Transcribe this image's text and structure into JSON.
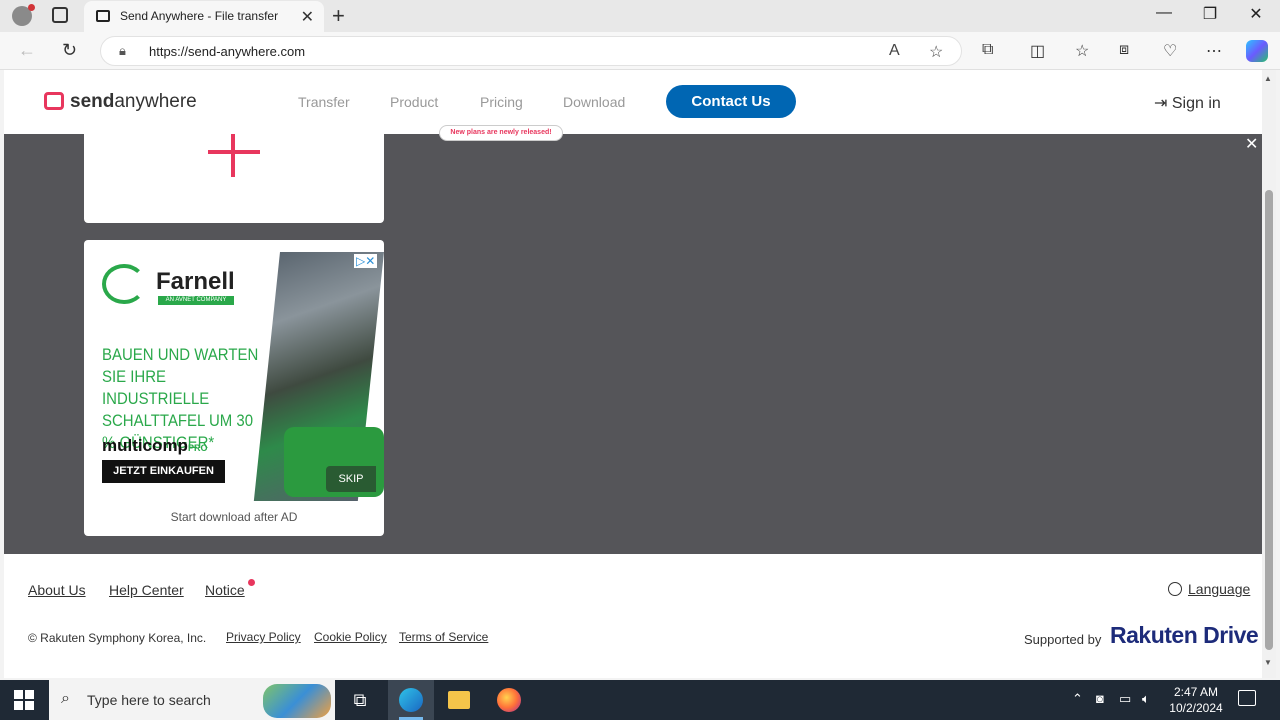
{
  "browser": {
    "tab_title": "Send Anywhere - File transfer",
    "url": "https://send-anywhere.com",
    "new_tab_glyph": "+",
    "tab_close_glyph": "✕"
  },
  "site": {
    "logo_prefix": "send",
    "logo_suffix": "anywhere",
    "nav": [
      "Transfer",
      "Product",
      "Pricing",
      "Download"
    ],
    "pricing_badge": "New plans are newly released!",
    "contact_button": "Contact Us",
    "sign_in": "Sign in",
    "overlay_close": "✕"
  },
  "ad": {
    "brand": "Farnell",
    "brand_sub": "AN AVNET COMPANY",
    "headline": "BAUEN UND WARTEN SIE IHRE INDUSTRIELLE SCHALTTAFEL UM 30 % GÜNSTIGER*",
    "product": "multicomp",
    "product_suffix": "PRO",
    "cta": "JETZT EINKAUFEN",
    "skip": "SKIP",
    "adchoices": "▷✕",
    "footer": "Start download after AD"
  },
  "footer": {
    "links": [
      "About Us",
      "Help Center",
      "Notice"
    ],
    "language": "Language",
    "copyright": "© Rakuten Symphony Korea, Inc.",
    "legal": [
      "Privacy Policy",
      "Cookie Policy",
      "Terms of Service"
    ],
    "supported_by": "Supported by",
    "partner_a": "Rakuten",
    "partner_b": "Drive"
  },
  "taskbar": {
    "search_placeholder": "Type here to search",
    "time": "2:47 AM",
    "date": "10/2/2024"
  },
  "colors": {
    "brand": "#e8365d",
    "contact": "#0066b3",
    "overlay": "#555559",
    "taskbar": "#1f2935"
  }
}
